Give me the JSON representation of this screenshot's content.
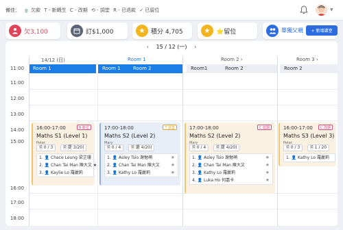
{
  "legend": {
    "label": "備佳：",
    "items": [
      "🍵 欠款",
      "T - 新轉生",
      "C - 改期",
      "⟲ - 調堂",
      "R - 已退款",
      "✓ 已留位"
    ]
  },
  "stats": [
    {
      "icon": "person",
      "text": "欠3,100",
      "color": "#e0445a"
    },
    {
      "icon": "calendar",
      "text": "訂$1,000",
      "color": "#5b6475"
    },
    {
      "icon": "star",
      "text": "積分 4,705",
      "color": "#f2b51f"
    },
    {
      "icon": "star",
      "text": "⭐留位",
      "color": "#f2b51f"
    },
    {
      "icon": "people",
      "text": "單獨父親",
      "color": "#2d6cdf"
    }
  ],
  "new_button": "+ 新增課堂",
  "date_nav": {
    "prev": "‹",
    "label": "15 / 12 (一)",
    "next": "›"
  },
  "day_headers": [
    {
      "label": "14/12 (日)",
      "color": "#555"
    },
    {
      "label": "Room 1",
      "color": "#1a73e8"
    },
    {
      "label": "Room 2  ›",
      "color": "#555"
    },
    {
      "label": "Room 3  ›",
      "color": "#555"
    }
  ],
  "rooms": [
    "Room 1",
    "Room 1",
    "Room 2",
    "Room1",
    "Room 2",
    "Room 2"
  ],
  "times": [
    "11:00",
    "11:00",
    "12:00",
    "13:00",
    "14:00",
    "15:00",
    "16:00",
    "17:00",
    "18:00"
  ],
  "classes": [
    {
      "time": "16:00-17:00",
      "tag": "N 新位",
      "tag_color": "#d64a7a",
      "title": "Maths S1 (Level 1)",
      "teacher": "Peter",
      "pills": [
        "🗎 0 / 3",
        "🗎 提 3/20)"
      ],
      "students": [
        "1. 👤 Chace Leung 梁芷珊",
        "2. 👤 Chan Tai Man 陳大文 ★",
        "3. 👤 Kaylie Lo 羅麗莉"
      ],
      "bg": "#fbf1e2",
      "border": "#f0c56c"
    },
    {
      "time": "17:00-18:00",
      "tag": "T 調堂",
      "tag_color": "#e5a020",
      "title": "Maths S2 (Level  2)",
      "teacher": "Mary",
      "pills": [
        "🗎 0 / 4",
        "🗎 還 4/20)"
      ],
      "students": [
        "1. 👤 Asley Tsio 謝勉萌",
        "2. 👤 Chan Tai Man 陳大文",
        "3. 👤 Kathy Lo 羅麗莉"
      ],
      "bg": "#e8eef8",
      "border": "#8fb0e4"
    },
    {
      "time": "17:00-18:00",
      "tag": "C 延期",
      "tag_color": "#d64a7a",
      "title": "Maths S2 (Level 2)",
      "teacher": "Mary",
      "pills": [
        "🗎 0 / 4",
        "🗎 提 4/20)"
      ],
      "students": [
        "1. 👤 Asley Tsio 謝勉萌",
        "2. 👤 Chan Tai Man 陳大文",
        "3. 👤 Kathy Lo 羅麗莉",
        "4. 👤 Luka Ho 何嘉卡"
      ],
      "bg": "#fbf1e2",
      "border": "#f0c56c"
    },
    {
      "time": "16:00-17:00",
      "tag": "C 改期",
      "tag_color": "#d64a7a",
      "title": "Maths S3 (Level 3)",
      "teacher": "Peter",
      "pills": [
        "🗎 0 / 3",
        "🗎 1 / 20"
      ],
      "students": [
        "1. 👤 Kathy Lo 羅麗莉"
      ],
      "bg": "#fbf1e2",
      "border": "#f0c56c"
    }
  ]
}
